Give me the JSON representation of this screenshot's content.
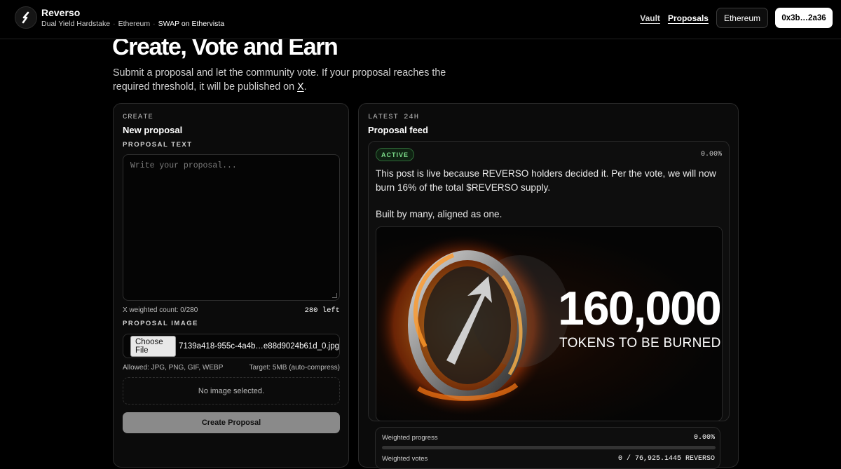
{
  "header": {
    "app_name": "Reverso",
    "breadcrumb": [
      "Dual Yield Hardstake",
      "Ethereum",
      "SWAP on Ethervista"
    ],
    "separator": "·",
    "nav": {
      "vault": "Vault",
      "proposals": "Proposals"
    },
    "chain_button": "Ethereum",
    "wallet_button": "0x3b…2a36"
  },
  "hero": {
    "title": "Create, Vote and Earn",
    "subtitle": "Submit a proposal and let the community vote. If your proposal reaches the required threshold, it will be published on",
    "x_link": "X",
    "period": "."
  },
  "create_card": {
    "eyebrow": "CREATE",
    "title": "New proposal",
    "text_label": "PROPOSAL TEXT",
    "text_placeholder": "Write your proposal...",
    "weighted_count": "X weighted count: 0/280",
    "chars_left": "280 left",
    "image_label": "PROPOSAL IMAGE",
    "choose_file": "Choose File",
    "file_name": "7139a418-955c-4a4b…e88d9024b61d_0.jpg",
    "allowed": "Allowed: JPG, PNG, GIF, WEBP",
    "target": "Target: 5MB (auto-compress)",
    "no_image": "No image selected.",
    "submit": "Create Proposal"
  },
  "feed_card": {
    "eyebrow": "LATEST 24H",
    "title": "Proposal feed",
    "post": {
      "status": "ACTIVE",
      "percent": "0.00%",
      "paragraph1": "This post is live because REVERSO holders decided it. Per the vote, we will now burn 16% of the total $REVERSO supply.",
      "paragraph2": "Built by many, aligned as one.",
      "image_number": "160,000",
      "image_caption": "TOKENS TO BE BURNED"
    },
    "progress": {
      "label": "Weighted progress",
      "percent": "0.00%",
      "fill_fraction": 0.0,
      "votes_label": "Weighted votes",
      "votes_value": "0 / 76,925.1445 REVERSO"
    }
  },
  "colors": {
    "background": "#000000",
    "active_badge": "#7ee08c",
    "button_primary": "#ffffff"
  }
}
